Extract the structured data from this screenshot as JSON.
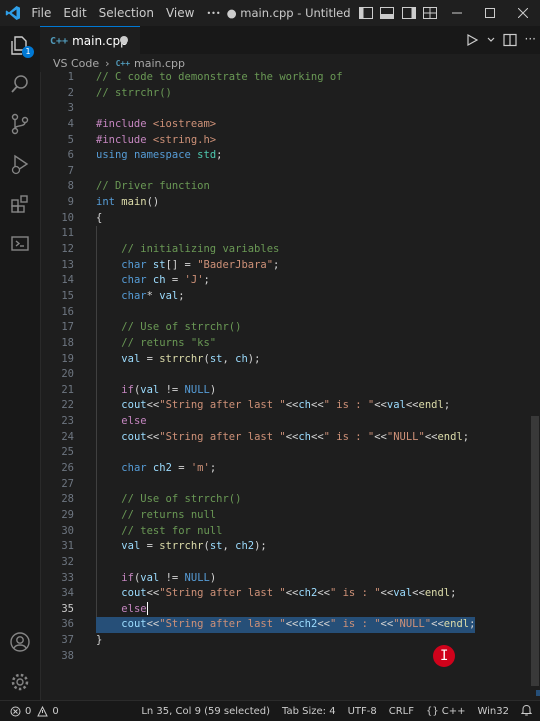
{
  "titlebar": {
    "menu": [
      "File",
      "Edit",
      "Selection",
      "View"
    ],
    "more": "•••",
    "title": "● main.cpp - Untitled (Works...",
    "window_controls": [
      "minimize-icon",
      "maximize-icon",
      "close-icon"
    ]
  },
  "activity_icons": [
    "explorer-icon",
    "search-icon",
    "source-control-icon",
    "run-debug-icon",
    "extensions-icon",
    "remote-explorer-icon",
    "accounts-icon",
    "manage-gear-icon"
  ],
  "explorer_badge": "1",
  "tab": {
    "icon": "C++",
    "label": "main.cpp"
  },
  "breadcrumb": {
    "folder": "VS Code",
    "file": "main.cpp"
  },
  "code_lines": [
    {
      "n": "1",
      "segs": [
        [
          "// C code to demonstrate the working of",
          "com"
        ]
      ]
    },
    {
      "n": "2",
      "segs": [
        [
          "// strrchr()",
          "com"
        ]
      ]
    },
    {
      "n": "3",
      "segs": []
    },
    {
      "n": "4",
      "segs": [
        [
          "#include",
          "pre"
        ],
        [
          " ",
          ""
        ],
        [
          "<iostream>",
          "str"
        ]
      ]
    },
    {
      "n": "5",
      "segs": [
        [
          "#include",
          "pre"
        ],
        [
          " ",
          ""
        ],
        [
          "<string.h>",
          "str"
        ]
      ]
    },
    {
      "n": "6",
      "segs": [
        [
          "using",
          "kw"
        ],
        [
          " ",
          ""
        ],
        [
          "namespace",
          "kw"
        ],
        [
          " ",
          ""
        ],
        [
          "std",
          "typ"
        ],
        [
          ";",
          ""
        ]
      ]
    },
    {
      "n": "7",
      "segs": []
    },
    {
      "n": "8",
      "segs": [
        [
          "// Driver function",
          "com"
        ]
      ]
    },
    {
      "n": "9",
      "segs": [
        [
          "int",
          "kw"
        ],
        [
          " ",
          ""
        ],
        [
          "main",
          "fn"
        ],
        [
          "()",
          ""
        ]
      ]
    },
    {
      "n": "10",
      "segs": [
        [
          "{",
          ""
        ]
      ]
    },
    {
      "n": "11",
      "segs": []
    },
    {
      "n": "12",
      "segs": [
        [
          "    ",
          ""
        ],
        [
          "// initializing variables",
          "com"
        ]
      ]
    },
    {
      "n": "13",
      "segs": [
        [
          "    ",
          ""
        ],
        [
          "char",
          "kw"
        ],
        [
          " ",
          ""
        ],
        [
          "st",
          "var"
        ],
        [
          "[] = ",
          ""
        ],
        [
          "\"BaderJbara\"",
          "str"
        ],
        [
          ";",
          ""
        ]
      ]
    },
    {
      "n": "14",
      "segs": [
        [
          "    ",
          ""
        ],
        [
          "char",
          "kw"
        ],
        [
          " ",
          ""
        ],
        [
          "ch",
          "var"
        ],
        [
          " = ",
          ""
        ],
        [
          "'J'",
          "str"
        ],
        [
          ";",
          ""
        ]
      ]
    },
    {
      "n": "15",
      "segs": [
        [
          "    ",
          ""
        ],
        [
          "char",
          "kw"
        ],
        [
          "* ",
          ""
        ],
        [
          "val",
          "var"
        ],
        [
          ";",
          ""
        ]
      ]
    },
    {
      "n": "16",
      "segs": []
    },
    {
      "n": "17",
      "segs": [
        [
          "    ",
          ""
        ],
        [
          "// Use of strrchr()",
          "com"
        ]
      ]
    },
    {
      "n": "18",
      "segs": [
        [
          "    ",
          ""
        ],
        [
          "// returns \"ks\"",
          "com"
        ]
      ]
    },
    {
      "n": "19",
      "segs": [
        [
          "    ",
          ""
        ],
        [
          "val",
          "var"
        ],
        [
          " = ",
          ""
        ],
        [
          "strrchr",
          "fn"
        ],
        [
          "(",
          ""
        ],
        [
          "st",
          "var"
        ],
        [
          ", ",
          ""
        ],
        [
          "ch",
          "var"
        ],
        [
          ");",
          ""
        ]
      ]
    },
    {
      "n": "20",
      "segs": []
    },
    {
      "n": "21",
      "segs": [
        [
          "    ",
          ""
        ],
        [
          "if",
          "ctl"
        ],
        [
          "(",
          ""
        ],
        [
          "val",
          "var"
        ],
        [
          " != ",
          ""
        ],
        [
          "NULL",
          "kw"
        ],
        [
          ")",
          ""
        ]
      ]
    },
    {
      "n": "22",
      "segs": [
        [
          "    ",
          ""
        ],
        [
          "cout",
          "var"
        ],
        [
          "<<",
          ""
        ],
        [
          "\"String after last \"",
          "str"
        ],
        [
          "<<",
          ""
        ],
        [
          "ch",
          "var"
        ],
        [
          "<<",
          ""
        ],
        [
          "\" is : \"",
          "str"
        ],
        [
          "<<",
          ""
        ],
        [
          "val",
          "var"
        ],
        [
          "<<",
          ""
        ],
        [
          "endl",
          "fn"
        ],
        [
          ";",
          ""
        ]
      ]
    },
    {
      "n": "23",
      "segs": [
        [
          "    ",
          ""
        ],
        [
          "else",
          "ctl"
        ]
      ]
    },
    {
      "n": "24",
      "segs": [
        [
          "    ",
          ""
        ],
        [
          "cout",
          "var"
        ],
        [
          "<<",
          ""
        ],
        [
          "\"String after last \"",
          "str"
        ],
        [
          "<<",
          ""
        ],
        [
          "ch",
          "var"
        ],
        [
          "<<",
          ""
        ],
        [
          "\" is : \"",
          "str"
        ],
        [
          "<<",
          ""
        ],
        [
          "\"NULL\"",
          "str"
        ],
        [
          "<<",
          ""
        ],
        [
          "endl",
          "fn"
        ],
        [
          ";",
          ""
        ]
      ]
    },
    {
      "n": "25",
      "segs": []
    },
    {
      "n": "26",
      "segs": [
        [
          "    ",
          ""
        ],
        [
          "char",
          "kw"
        ],
        [
          " ",
          ""
        ],
        [
          "ch2",
          "var"
        ],
        [
          " = ",
          ""
        ],
        [
          "'m'",
          "str"
        ],
        [
          ";",
          ""
        ]
      ]
    },
    {
      "n": "27",
      "segs": []
    },
    {
      "n": "28",
      "segs": [
        [
          "    ",
          ""
        ],
        [
          "// Use of strrchr()",
          "com"
        ]
      ]
    },
    {
      "n": "29",
      "segs": [
        [
          "    ",
          ""
        ],
        [
          "// returns null",
          "com"
        ]
      ]
    },
    {
      "n": "30",
      "segs": [
        [
          "    ",
          ""
        ],
        [
          "// test for null",
          "com"
        ]
      ]
    },
    {
      "n": "31",
      "segs": [
        [
          "    ",
          ""
        ],
        [
          "val",
          "var"
        ],
        [
          " = ",
          ""
        ],
        [
          "strrchr",
          "fn"
        ],
        [
          "(",
          ""
        ],
        [
          "st",
          "var"
        ],
        [
          ", ",
          ""
        ],
        [
          "ch2",
          "var"
        ],
        [
          ");",
          ""
        ]
      ]
    },
    {
      "n": "32",
      "segs": []
    },
    {
      "n": "33",
      "segs": [
        [
          "    ",
          ""
        ],
        [
          "if",
          "ctl"
        ],
        [
          "(",
          ""
        ],
        [
          "val",
          "var"
        ],
        [
          " != ",
          ""
        ],
        [
          "NULL",
          "kw"
        ],
        [
          ")",
          ""
        ]
      ]
    },
    {
      "n": "34",
      "segs": [
        [
          "    ",
          ""
        ],
        [
          "cout",
          "var"
        ],
        [
          "<<",
          ""
        ],
        [
          "\"String after last \"",
          "str"
        ],
        [
          "<<",
          ""
        ],
        [
          "ch2",
          "var"
        ],
        [
          "<<",
          ""
        ],
        [
          "\" is : \"",
          "str"
        ],
        [
          "<<",
          ""
        ],
        [
          "val",
          "var"
        ],
        [
          "<<",
          ""
        ],
        [
          "endl",
          "fn"
        ],
        [
          ";",
          ""
        ]
      ]
    },
    {
      "n": "35",
      "segs": [
        [
          "    ",
          ""
        ],
        [
          "else",
          "ctl"
        ]
      ],
      "cursor": true,
      "active": true
    },
    {
      "n": "36",
      "segs": [
        [
          "    ",
          ""
        ],
        [
          "cout",
          "var"
        ],
        [
          "<<",
          ""
        ],
        [
          "\"String after last \"",
          "str"
        ],
        [
          "<<",
          ""
        ],
        [
          "ch2",
          "var"
        ],
        [
          "<<",
          ""
        ],
        [
          "\" is : \"",
          "str"
        ],
        [
          "<<",
          ""
        ],
        [
          "\"NULL\"",
          "str"
        ],
        [
          "<<",
          ""
        ],
        [
          "endl",
          "fn"
        ],
        [
          ";",
          ""
        ]
      ],
      "selected": true
    },
    {
      "n": "37",
      "segs": [
        [
          "}",
          ""
        ]
      ]
    },
    {
      "n": "38",
      "segs": []
    }
  ],
  "statusbar": {
    "problems": "0",
    "warnings": "0",
    "position": "Ln 35, Col 9 (59 selected)",
    "tab_size": "Tab Size: 4",
    "encoding": "UTF-8",
    "eol": "CRLF",
    "language": "C++",
    "platform": "Win32"
  },
  "colors": {
    "accent": "#0078d4",
    "selection": "#264f78",
    "mouse_highlight": "#d0021b"
  }
}
